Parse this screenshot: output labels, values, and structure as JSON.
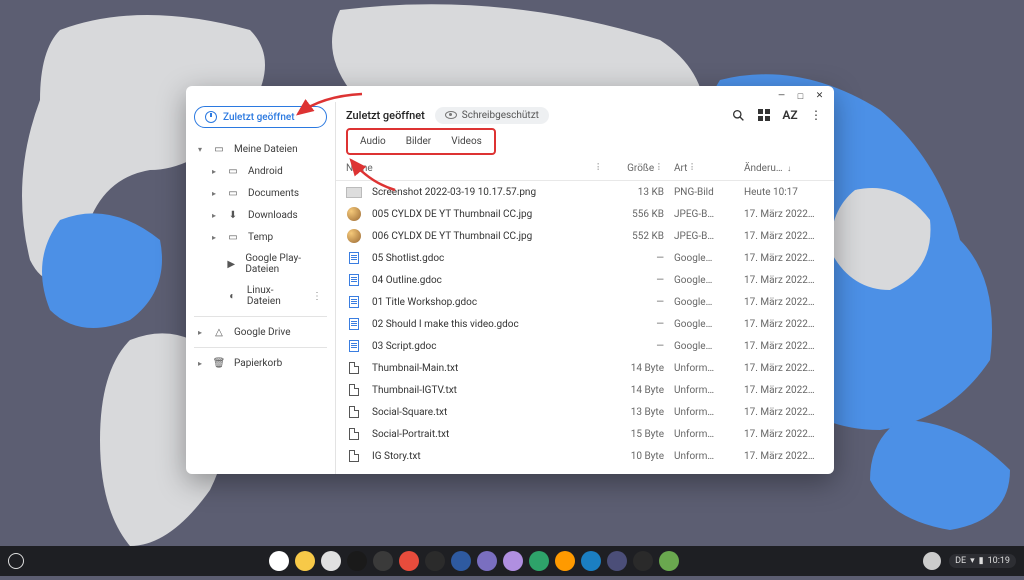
{
  "sidebar": {
    "recent_label": "Zuletzt geöffnet",
    "my_files": "Meine Dateien",
    "folders": [
      "Android",
      "Documents",
      "Downloads",
      "Temp"
    ],
    "play_files": "Google Play-Dateien",
    "linux_files": "Linux-Dateien",
    "drive": "Google Drive",
    "trash": "Papierkorb"
  },
  "main": {
    "title": "Zuletzt geöffnet",
    "readonly_label": "Schreibgeschützt",
    "tabs": [
      "Audio",
      "Bilder",
      "Videos"
    ],
    "columns": {
      "name": "Name",
      "size": "Größe",
      "type": "Art",
      "date": "Änderu…"
    },
    "files": [
      {
        "icon": "img",
        "name": "Screenshot 2022-03-19 10.17.57.png",
        "size": "13 KB",
        "type": "PNG-Bild",
        "date": "Heute 10:17"
      },
      {
        "icon": "thumb",
        "name": "005 CYLDX DE YT Thumbnail CC.jpg",
        "size": "556 KB",
        "type": "JPEG-B…",
        "date": "17. März 2022…"
      },
      {
        "icon": "thumb",
        "name": "006 CYLDX DE YT Thumbnail CC.jpg",
        "size": "552 KB",
        "type": "JPEG-B…",
        "date": "17. März 2022…"
      },
      {
        "icon": "gdoc",
        "name": "05 Shotlist.gdoc",
        "size": "—",
        "type": "Google…",
        "date": "17. März 2022…"
      },
      {
        "icon": "gdoc",
        "name": "04 Outline.gdoc",
        "size": "—",
        "type": "Google…",
        "date": "17. März 2022…"
      },
      {
        "icon": "gdoc",
        "name": "01 Title Workshop.gdoc",
        "size": "—",
        "type": "Google…",
        "date": "17. März 2022…"
      },
      {
        "icon": "gdoc",
        "name": "02 Should I make this video.gdoc",
        "size": "—",
        "type": "Google…",
        "date": "17. März 2022…"
      },
      {
        "icon": "gdoc",
        "name": "03 Script.gdoc",
        "size": "—",
        "type": "Google…",
        "date": "17. März 2022…"
      },
      {
        "icon": "txt",
        "name": "Thumbnail-Main.txt",
        "size": "14 Byte",
        "type": "Unform…",
        "date": "17. März 2022…"
      },
      {
        "icon": "txt",
        "name": "Thumbnail-IGTV.txt",
        "size": "14 Byte",
        "type": "Unform…",
        "date": "17. März 2022…"
      },
      {
        "icon": "txt",
        "name": "Social-Square.txt",
        "size": "13 Byte",
        "type": "Unform…",
        "date": "17. März 2022…"
      },
      {
        "icon": "txt",
        "name": "Social-Portrait.txt",
        "size": "15 Byte",
        "type": "Unform…",
        "date": "17. März 2022…"
      },
      {
        "icon": "txt",
        "name": "IG Story.txt",
        "size": "10 Byte",
        "type": "Unform…",
        "date": "17. März 2022…"
      }
    ]
  },
  "taskbar": {
    "apps": [
      "#fff:chrome",
      "#f7c948:drive",
      "#e0e0e0:files",
      "#1a1a1a:notion",
      "#3a3a3a:power",
      "#e74c3c:asana",
      "#2b2b2b:adobe",
      "#2e5aa0:lr",
      "#7a6fc0:capture",
      "#b08fe0:figma",
      "#2ea36a:spotify",
      "#ff9a00:canva",
      "#1b7fc2:ps",
      "#4b4e78:unknown",
      "#2a2a2a:term",
      "#6aa84f:tag"
    ],
    "lang": "DE",
    "clock": "10:19"
  }
}
